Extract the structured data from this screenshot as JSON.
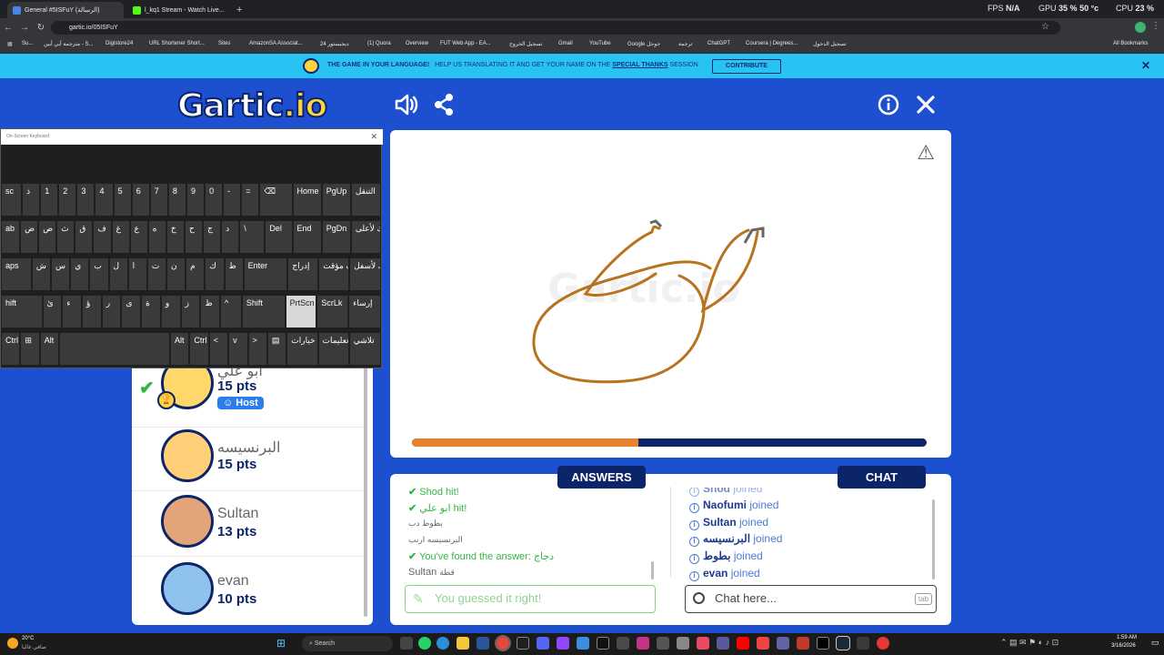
{
  "browser": {
    "tabs": [
      {
        "label": "General #5ISFuY (الرسالة)",
        "active": true
      },
      {
        "label": "l_kq1 Stream - Watch Live...",
        "active": false
      }
    ],
    "new_tab_label": "+",
    "stats": {
      "fps_label": "FPS",
      "fps_value": "N/A",
      "gpu_label": "GPU",
      "gpu_value": "35 %",
      "gpu_temp": "50 °c",
      "cpu_label": "CPU",
      "cpu_value": "23 %"
    },
    "url": "gartic.io/05ISFuY",
    "bookmarks": [
      "Su...",
      "مترجمة أبي أبين - S...",
      "Digistore24",
      "URL Shortener Short...",
      "Sites",
      "AmazonSA Associat...",
      "24 ديجيستور",
      "(1) Quora",
      "Overview",
      "FUT Web App - EA...",
      "تسجيل الخروج",
      "Gmail",
      "YouTube",
      "Google جوجل",
      "ترجمة",
      "ChatGPT",
      "Coursera | Degrees...",
      "تسجيل الدخول"
    ],
    "all_bookmarks": "All Bookmarks"
  },
  "banner": {
    "headline": "THE GAME IN YOUR LANGUAGE!",
    "body": "HELP US TRANSLATING IT AND GET YOUR NAME ON THE",
    "link": "SPECIAL THANKS",
    "tail": "SESSION",
    "cta": "CONTRIBUTE",
    "close": "✕"
  },
  "game": {
    "logo_main": "Gartic",
    "logo_suffix": ".io",
    "watermark": "Gartic.io",
    "report_icon": "⚠",
    "progress": 0.44,
    "stroke_color": "#b8731f",
    "accent": "#0c2468"
  },
  "keyboard": {
    "title": "On-Screen Keyboard",
    "rows": [
      [
        "sc",
        "ذ",
        "1",
        "2",
        "3",
        "4",
        "5",
        "6",
        "7",
        "8",
        "9",
        "0",
        "-",
        "=",
        "⌫",
        "Home",
        "PgUp",
        "التنقل"
      ],
      [
        "ab",
        "ض",
        "ص",
        "ث",
        "ق",
        "ف",
        "غ",
        "ع",
        "ه",
        "خ",
        "ح",
        "ج",
        "د",
        "\\",
        "Del",
        "End",
        "PgDn",
        "حرك لأعلى"
      ],
      [
        "aps",
        "ش",
        "س",
        "ي",
        "ب",
        "ل",
        "ا",
        "ت",
        "ن",
        "م",
        "ك",
        "ط",
        "Enter",
        "إدراج",
        "إيقاف مؤقت",
        "حرك لأسفل"
      ],
      [
        "hift",
        "ئ",
        "ء",
        "ؤ",
        "ر",
        "ى",
        "ة",
        "و",
        "ز",
        "ظ",
        "^",
        "Shift",
        "PrtScn",
        "ScrLk",
        "إرساء"
      ],
      [
        "Ctrl",
        "⊞",
        "Alt",
        "",
        "Alt",
        "Ctrl",
        "<",
        "v",
        ">",
        "▤",
        "خيارات",
        "تعليمات",
        "تلاشي"
      ]
    ]
  },
  "players": [
    {
      "name": "أبو علي",
      "points": "15 pts",
      "badge": "Host",
      "guessed": true
    },
    {
      "name": "البرنسيسه",
      "points": "15 pts"
    },
    {
      "name": "Sultan",
      "points": "13 pts"
    },
    {
      "name": "evan",
      "points": "10 pts"
    }
  ],
  "answers": {
    "tab_label": "ANSWERS",
    "messages": [
      {
        "user": "Shod",
        "text": "hit!",
        "type": "hit"
      },
      {
        "user": "ابو علي",
        "text": "hit!",
        "type": "hit"
      },
      {
        "user": "بطوط",
        "text": "دب",
        "type": "guess"
      },
      {
        "user": "البرنسيسه",
        "text": "ارنب",
        "type": "guess"
      },
      {
        "user": "",
        "text": "You've found the answer: دجاج",
        "type": "found"
      },
      {
        "user": "Sultan",
        "text": "قطة",
        "type": "guess"
      }
    ],
    "input_placeholder": "You guessed it right!"
  },
  "chat": {
    "tab_label": "CHAT",
    "messages": [
      {
        "user": "Shod",
        "text": "joined"
      },
      {
        "user": "Naofumi",
        "text": "joined"
      },
      {
        "user": "Sultan",
        "text": "joined"
      },
      {
        "user": "البرنسيسه",
        "text": "joined"
      },
      {
        "user": "بطوط",
        "text": "joined"
      },
      {
        "user": "evan",
        "text": "joined"
      }
    ],
    "input_placeholder": "Chat here...",
    "tab_hint": "tab"
  },
  "taskbar": {
    "weather_temp": "20°C",
    "weather_desc": "صافي غالبا",
    "search": "Search",
    "time": "1:59 AM",
    "date": "3/16/2026"
  }
}
